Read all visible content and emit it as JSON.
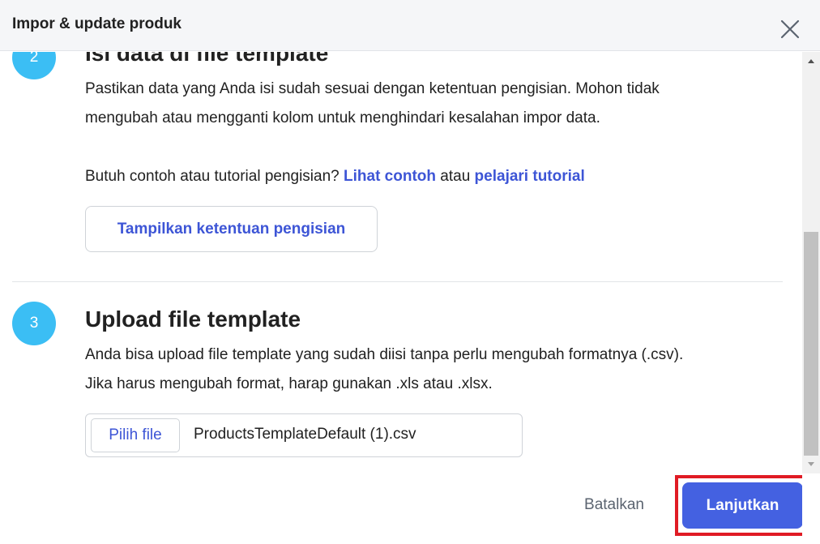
{
  "dialog": {
    "title": "Impor & update produk",
    "close_icon": "close-icon"
  },
  "step2": {
    "number": "2",
    "title": "Isi data di file template",
    "desc_line1": "Pastikan data yang Anda isi sudah sesuai dengan ketentuan pengisian. Mohon tidak",
    "desc_line2": "mengubah atau mengganti kolom untuk menghindari kesalahan impor data.",
    "help_prefix": "Butuh contoh atau tutorial pengisian?",
    "example_link": "Lihat contoh",
    "help_middle": "atau",
    "tutorial_link": "pelajari tutorial",
    "rules_button": "Tampilkan ketentuan pengisian"
  },
  "step3": {
    "number": "3",
    "title": "Upload file template",
    "desc_line1": "Anda bisa upload file template yang sudah diisi tanpa perlu mengubah formatnya (.csv).",
    "desc_line2": "Jika harus mengubah format, harap gunakan .xls atau .xlsx.",
    "choose_file_button": "Pilih file",
    "file_name": "ProductsTemplateDefault (1).csv"
  },
  "footer": {
    "cancel_label": "Batalkan",
    "continue_label": "Lanjutkan"
  },
  "colors": {
    "accent": "#4461e1",
    "link": "#3d55d6",
    "step_circle": "#3bbef4",
    "highlight": "#e01b24"
  }
}
